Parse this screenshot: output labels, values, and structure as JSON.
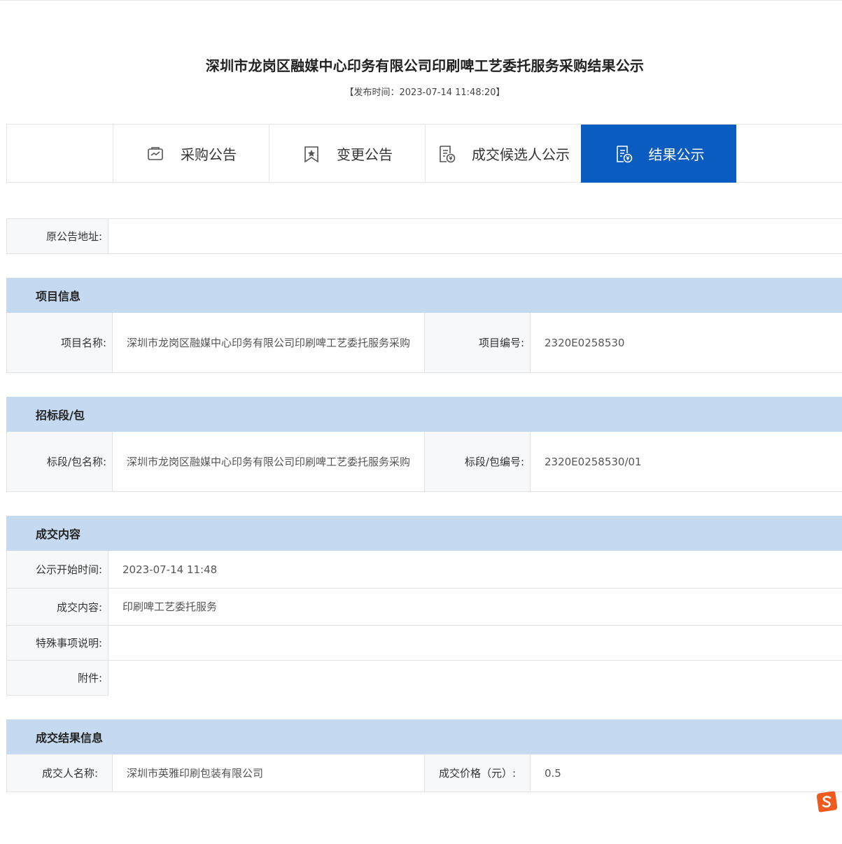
{
  "header": {
    "title": "深圳市龙岗区融媒中心印务有限公司印刷啤工艺委托服务采购结果公示",
    "publish_time": "【发布时间：2023-07-14 11:48:20】"
  },
  "tabs": [
    {
      "label": "采购公告",
      "icon": "procurement-notice-icon",
      "active": false
    },
    {
      "label": "变更公告",
      "icon": "bookmark-star-icon",
      "active": false
    },
    {
      "label": "成交候选人公示",
      "icon": "document-yuan-icon",
      "active": false
    },
    {
      "label": "结果公示",
      "icon": "result-yuan-icon",
      "active": true
    }
  ],
  "original_notice": {
    "label": "原公告地址:",
    "value": ""
  },
  "project_info": {
    "title": "项目信息",
    "name_label": "项目名称:",
    "name_value": "深圳市龙岗区融媒中心印务有限公司印刷啤工艺委托服务采购",
    "code_label": "项目编号:",
    "code_value": "2320E0258530"
  },
  "section_pkg": {
    "title": "招标段/包",
    "name_label": "标段/包名称:",
    "name_value": "深圳市龙岗区融媒中心印务有限公司印刷啤工艺委托服务采购",
    "code_label": "标段/包编号:",
    "code_value": "2320E0258530/01"
  },
  "deal_content": {
    "title": "成交内容",
    "start_label": "公示开始时间:",
    "start_value": "2023-07-14 11:48",
    "content_label": "成交内容:",
    "content_value": "印刷啤工艺委托服务",
    "special_label": "特殊事项说明:",
    "special_value": "",
    "attach_label": "附件:",
    "attach_value": ""
  },
  "deal_result": {
    "title": "成交结果信息",
    "winner_label": "成交人名称:",
    "winner_value": "深圳市英雅印刷包装有限公司",
    "price_label": "成交价格（元）:",
    "price_value": "0.5"
  },
  "colors": {
    "accent": "#0b5cc0",
    "section_bg": "#c5daf1",
    "label_bg": "#f7f8fa"
  }
}
